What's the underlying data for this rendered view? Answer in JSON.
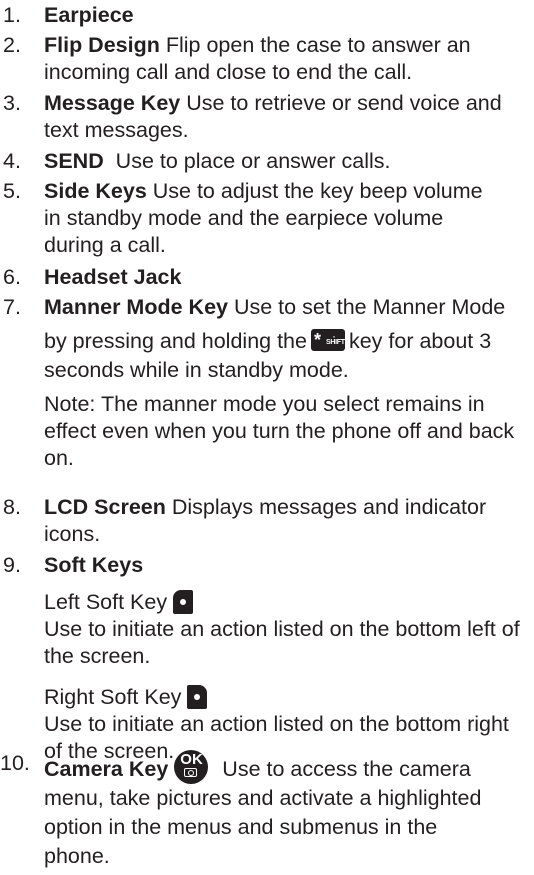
{
  "items": [
    {
      "num": "1.",
      "title": "Earpiece",
      "text": ""
    },
    {
      "num": "2.",
      "title": "Flip Design",
      "text": " Flip open the case to answer an incoming call and close to end the call."
    },
    {
      "num": "3.",
      "title": "Message Key",
      "text": " Use to retrieve or send voice and text messages."
    },
    {
      "num": "4.",
      "title": "SEND",
      "text": "  Use to place or answer calls."
    },
    {
      "num": "5.",
      "title": "Side Keys",
      "text": " Use to adjust the key beep volume in standby mode and the earpiece volume during a call."
    },
    {
      "num": "6.",
      "title": "Headset Jack",
      "text": ""
    },
    {
      "num": "7.",
      "title": "Manner Mode Key",
      "text_a": " Use to set the Manner Mode",
      "text_b": "by pressing and holding the",
      "text_c": "key for about 3 seconds while in standby mode.",
      "note": "Note: The manner mode you select remains in effect even when you turn the phone off and back on."
    },
    {
      "num": "8.",
      "title": "LCD Screen",
      "text": " Displays messages and indicator icons."
    },
    {
      "num": "9.",
      "title": "Soft Keys",
      "left_label": "Left Soft Key",
      "left_desc": "Use to initiate an action listed on the bottom left of the screen.",
      "right_label": "Right Soft Key",
      "right_desc": "Use to initiate an action listed on the bottom right of the screen."
    },
    {
      "num": "10.",
      "title": "Camera Key",
      "text_a": "Use to access the camera",
      "text_b": "menu, take pictures and activate a highlighted",
      "text_c": "option in the menus and submenus in the",
      "text_d": "phone."
    }
  ],
  "icons": {
    "star_key": "star-shift-key-icon",
    "star_top": "*",
    "star_shift": "SHIFT",
    "ok_text": "OK"
  }
}
